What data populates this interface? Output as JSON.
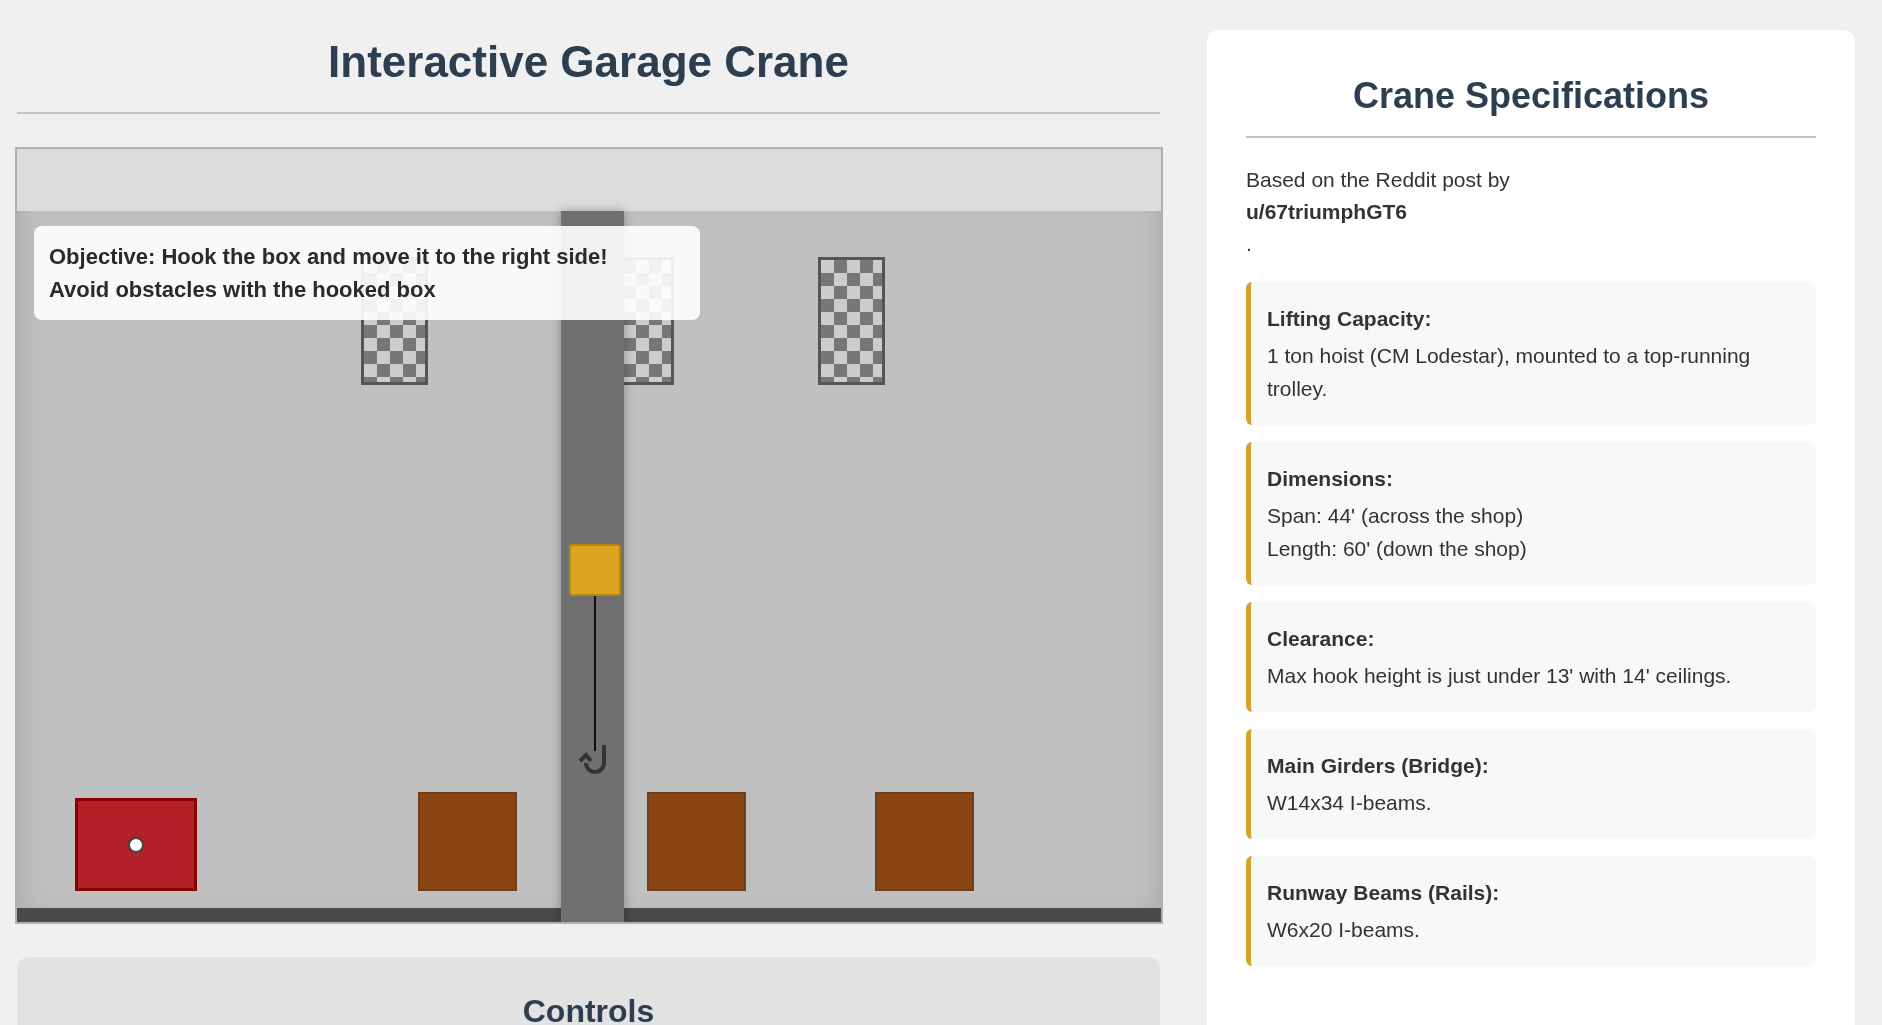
{
  "title": "Interactive Garage Crane",
  "scene": {
    "objective": [
      "Objective: Hook the box and move it to the right side!",
      "Avoid obstacles with the hooked box"
    ]
  },
  "controls": {
    "title": "Controls"
  },
  "specs": {
    "title": "Crane Specifications",
    "intro": "Based on the Reddit post by **u/67triumphGT6**.",
    "items": [
      {
        "label": "Lifting Capacity:",
        "text": "1 ton hoist (CM Lodestar), mounted to a top-running trolley."
      },
      {
        "label": "Dimensions:",
        "lines": [
          "Span: 44' (across the shop)",
          "Length: 60' (down the shop)"
        ]
      },
      {
        "label": "Clearance:",
        "text": "Max hook height is just under 13' with 14' ceilings."
      },
      {
        "label": "Main Girders (Bridge):",
        "text": "W14x34 I-beams."
      },
      {
        "label": "Runway Beams (Rails):",
        "text": "W6x20 I-beams."
      }
    ]
  }
}
